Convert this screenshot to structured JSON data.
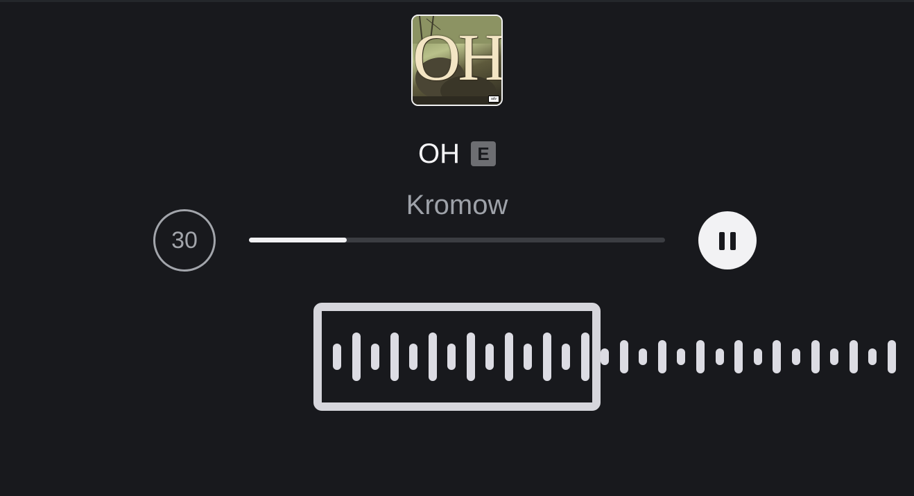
{
  "album": {
    "cover_text": "OH",
    "advisory_label": "adv"
  },
  "track": {
    "title": "OH",
    "explicit_badge": "E",
    "artist": "Kromow"
  },
  "controls": {
    "skip_label": "30",
    "skip_icon": "rewind-30-icon",
    "progress_fraction": 0.235,
    "play_state_icon": "pause-icon"
  },
  "waveform": {
    "selected_bar_heights": [
      38,
      70,
      38,
      70,
      38,
      70,
      38,
      70,
      38,
      70,
      38,
      70,
      38,
      70
    ],
    "unselected_bar_heights": [
      24,
      48,
      24,
      48,
      24,
      48,
      24,
      48,
      24,
      48,
      24,
      48,
      24,
      48,
      24,
      48
    ],
    "selected_color": "#dcdce3",
    "frame_color": "#d6d6dc"
  },
  "colors": {
    "background": "#18191d",
    "artist_text": "#9ea2a9",
    "progress_fill": "#f1f1f3",
    "progress_track": "#3b3d42"
  }
}
